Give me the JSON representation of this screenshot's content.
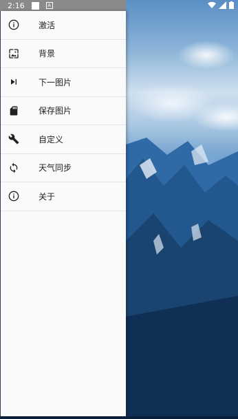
{
  "status_bar": {
    "time": "2:16",
    "a_indicator": "A",
    "icons": [
      "notification-square-icon",
      "a-badge-icon",
      "wifi-icon",
      "signal-icon",
      "battery-icon"
    ]
  },
  "drawer": {
    "items": [
      {
        "label": "激活",
        "icon": "info-icon"
      },
      {
        "label": "背景",
        "icon": "wallpaper-icon"
      },
      {
        "label": "下一图片",
        "icon": "skip-next-icon"
      },
      {
        "label": "保存图片",
        "icon": "sd-card-icon"
      },
      {
        "label": "自定义",
        "icon": "wrench-icon"
      },
      {
        "label": "天气同步",
        "icon": "sync-icon"
      },
      {
        "label": "关于",
        "icon": "info-icon"
      }
    ]
  },
  "colors": {
    "drawer_bg": "#fafafa",
    "divider": "#e3e3e3",
    "status_bar": "#8a8a8a",
    "text": "#212121"
  }
}
